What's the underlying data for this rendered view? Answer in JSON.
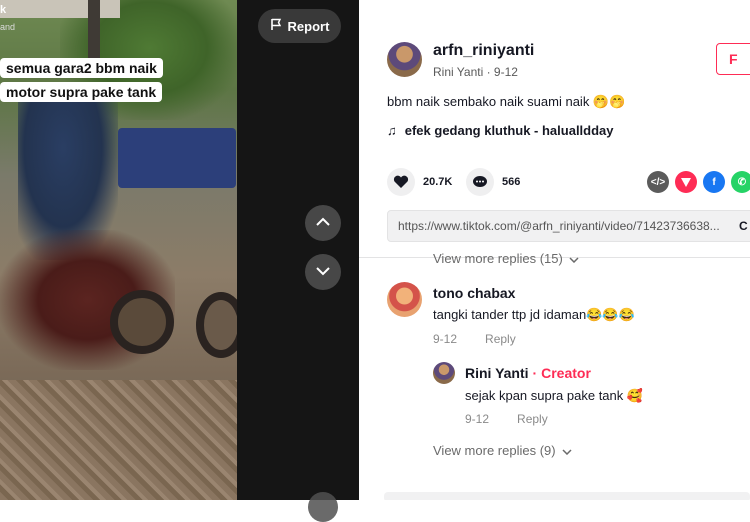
{
  "video": {
    "logo_text": "k",
    "logo_sub": "and",
    "caption_line1": "semua gara2 bbm naik",
    "caption_line2": "motor supra pake tank"
  },
  "controls": {
    "report_label": "Report"
  },
  "post": {
    "username": "arfn_riniyanti",
    "nickname_date": "Rini Yanti · 9-12",
    "follow_label": "F",
    "description": "bbm naik sembako naik suami naik 🤭🤭",
    "music": "efek gedang kluthuk - halualldday",
    "likes": "20.7K",
    "comments": "566",
    "link_url": "https://www.tiktok.com/@arfn_riniyanti/video/71423736638...",
    "copy_label": "C"
  },
  "comments": {
    "view_more_top": "View more replies (15)",
    "items": [
      {
        "name": "tono chabax",
        "text": "tangki tander ttp jd idaman😂😂😂",
        "date": "9-12",
        "reply_label": "Reply"
      }
    ],
    "reply": {
      "name": "Rini Yanti",
      "badge": "· Creator",
      "text": "sejak kpan supra pake tank 🥰",
      "date": "9-12",
      "reply_label": "Reply"
    },
    "view_more_bottom": "View more replies (9)"
  }
}
